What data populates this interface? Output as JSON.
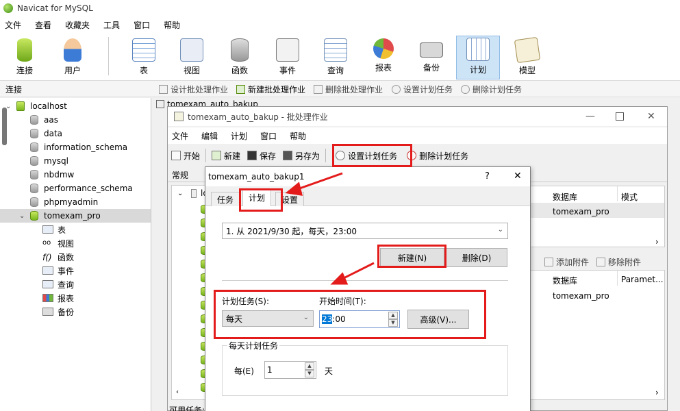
{
  "app": {
    "title": "Navicat for MySQL"
  },
  "menubar": [
    "文件",
    "查看",
    "收藏夹",
    "工具",
    "窗口",
    "帮助"
  ],
  "toolbar": [
    {
      "label": "连接",
      "icon": "connect-icon"
    },
    {
      "label": "用户",
      "icon": "user-icon"
    },
    {
      "label": "表",
      "icon": "table-icon"
    },
    {
      "label": "视图",
      "icon": "view-icon"
    },
    {
      "label": "函数",
      "icon": "function-icon"
    },
    {
      "label": "事件",
      "icon": "event-icon"
    },
    {
      "label": "查询",
      "icon": "query-icon"
    },
    {
      "label": "报表",
      "icon": "report-icon"
    },
    {
      "label": "备份",
      "icon": "backup-icon"
    },
    {
      "label": "计划",
      "icon": "schedule-icon"
    },
    {
      "label": "模型",
      "icon": "model-icon"
    }
  ],
  "strip": {
    "label": "连接",
    "items": [
      "设计批处理作业",
      "新建批处理作业",
      "删除批处理作业",
      "设置计划任务",
      "删除计划任务"
    ]
  },
  "tree": {
    "root": "localhost",
    "databases": [
      "aas",
      "data",
      "information_schema",
      "mysql",
      "nbdmw",
      "performance_schema",
      "phpmyadmin",
      "tomexam_pro"
    ],
    "children": [
      "表",
      "视图",
      "函数",
      "事件",
      "查询",
      "报表",
      "备份"
    ]
  },
  "bg_tab": "tomexam_auto_bakup",
  "batch": {
    "title": "tomexam_auto_bakup - 批处理作业",
    "menu": [
      "文件",
      "编辑",
      "计划",
      "窗口",
      "帮助"
    ],
    "tools": [
      "开始",
      "新建",
      "保存",
      "另存为",
      "设置计划任务",
      "删除计划任务"
    ],
    "tab": "常规",
    "tree_prefix": "lo",
    "top_headers": [
      "数据库",
      "模式"
    ],
    "top_row": "tomexam_pro",
    "attach": [
      "添加附件",
      "移除附件"
    ],
    "bottom_headers": [
      "数据库",
      "Paramet..."
    ],
    "bottom_row": "tomexam_pro",
    "status": "可用任务:"
  },
  "dialog": {
    "title": "tomexam_auto_bakup1",
    "help": "?",
    "close": "✕",
    "tabs": [
      "任务",
      "计划",
      "设置"
    ],
    "schedule_value": "1. 从 2021/9/30 起，每天，23:00",
    "new_button": "新建(N)",
    "delete_button": "删除(D)",
    "task_label": "计划任务(S):",
    "task_value": "每天",
    "start_label": "开始时间(T):",
    "start_hour": "23",
    "start_rest": ":00",
    "advanced_button": "高级(V)...",
    "group_label": "每天计划任务",
    "every_label": "每(E)",
    "every_value": "1",
    "unit": "天"
  },
  "colors": {
    "highlight": "#e41b1b",
    "selected_tool": "#cde4f7",
    "db_green": "#7ab81e"
  }
}
